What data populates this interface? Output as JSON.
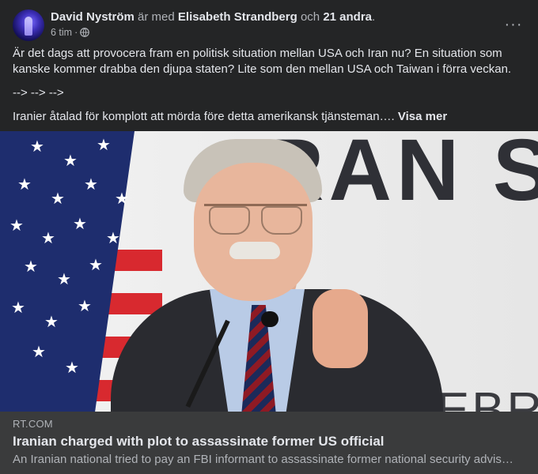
{
  "post": {
    "author": "David Nyström",
    "with_text": " är med ",
    "tagged": "Elisabeth Strandberg",
    "and_text": " och ",
    "others": "21 andra",
    "period": ".",
    "time": "6 tim",
    "separator": "·",
    "privacy_icon": "globe-icon",
    "more_icon": "more-horizontal-icon",
    "more_label": "···",
    "paragraphs": [
      "Är det dags att provocera fram en politisk situation mellan USA och Iran nu? En situation som kanske kommer drabba den djupa staten? Lite som den mellan USA och Taiwan i förra veckan.",
      "--> --> -->",
      "Iranier åtalad för komplott att mörda före detta amerikansk tjänsteman…."
    ],
    "see_more": "Visa mer"
  },
  "image": {
    "background_text_top": "RAN S",
    "background_text_bottom": "ELEBR"
  },
  "link": {
    "domain": "RT.COM",
    "title": "Iranian charged with plot to assassinate former US official",
    "description": "An Iranian national tried to pay an FBI informant to assassinate former national security advis…"
  },
  "colors": {
    "background": "#242526",
    "text_primary": "#e4e6eb",
    "text_secondary": "#b0b3b8",
    "link_box": "#3a3b3c"
  }
}
